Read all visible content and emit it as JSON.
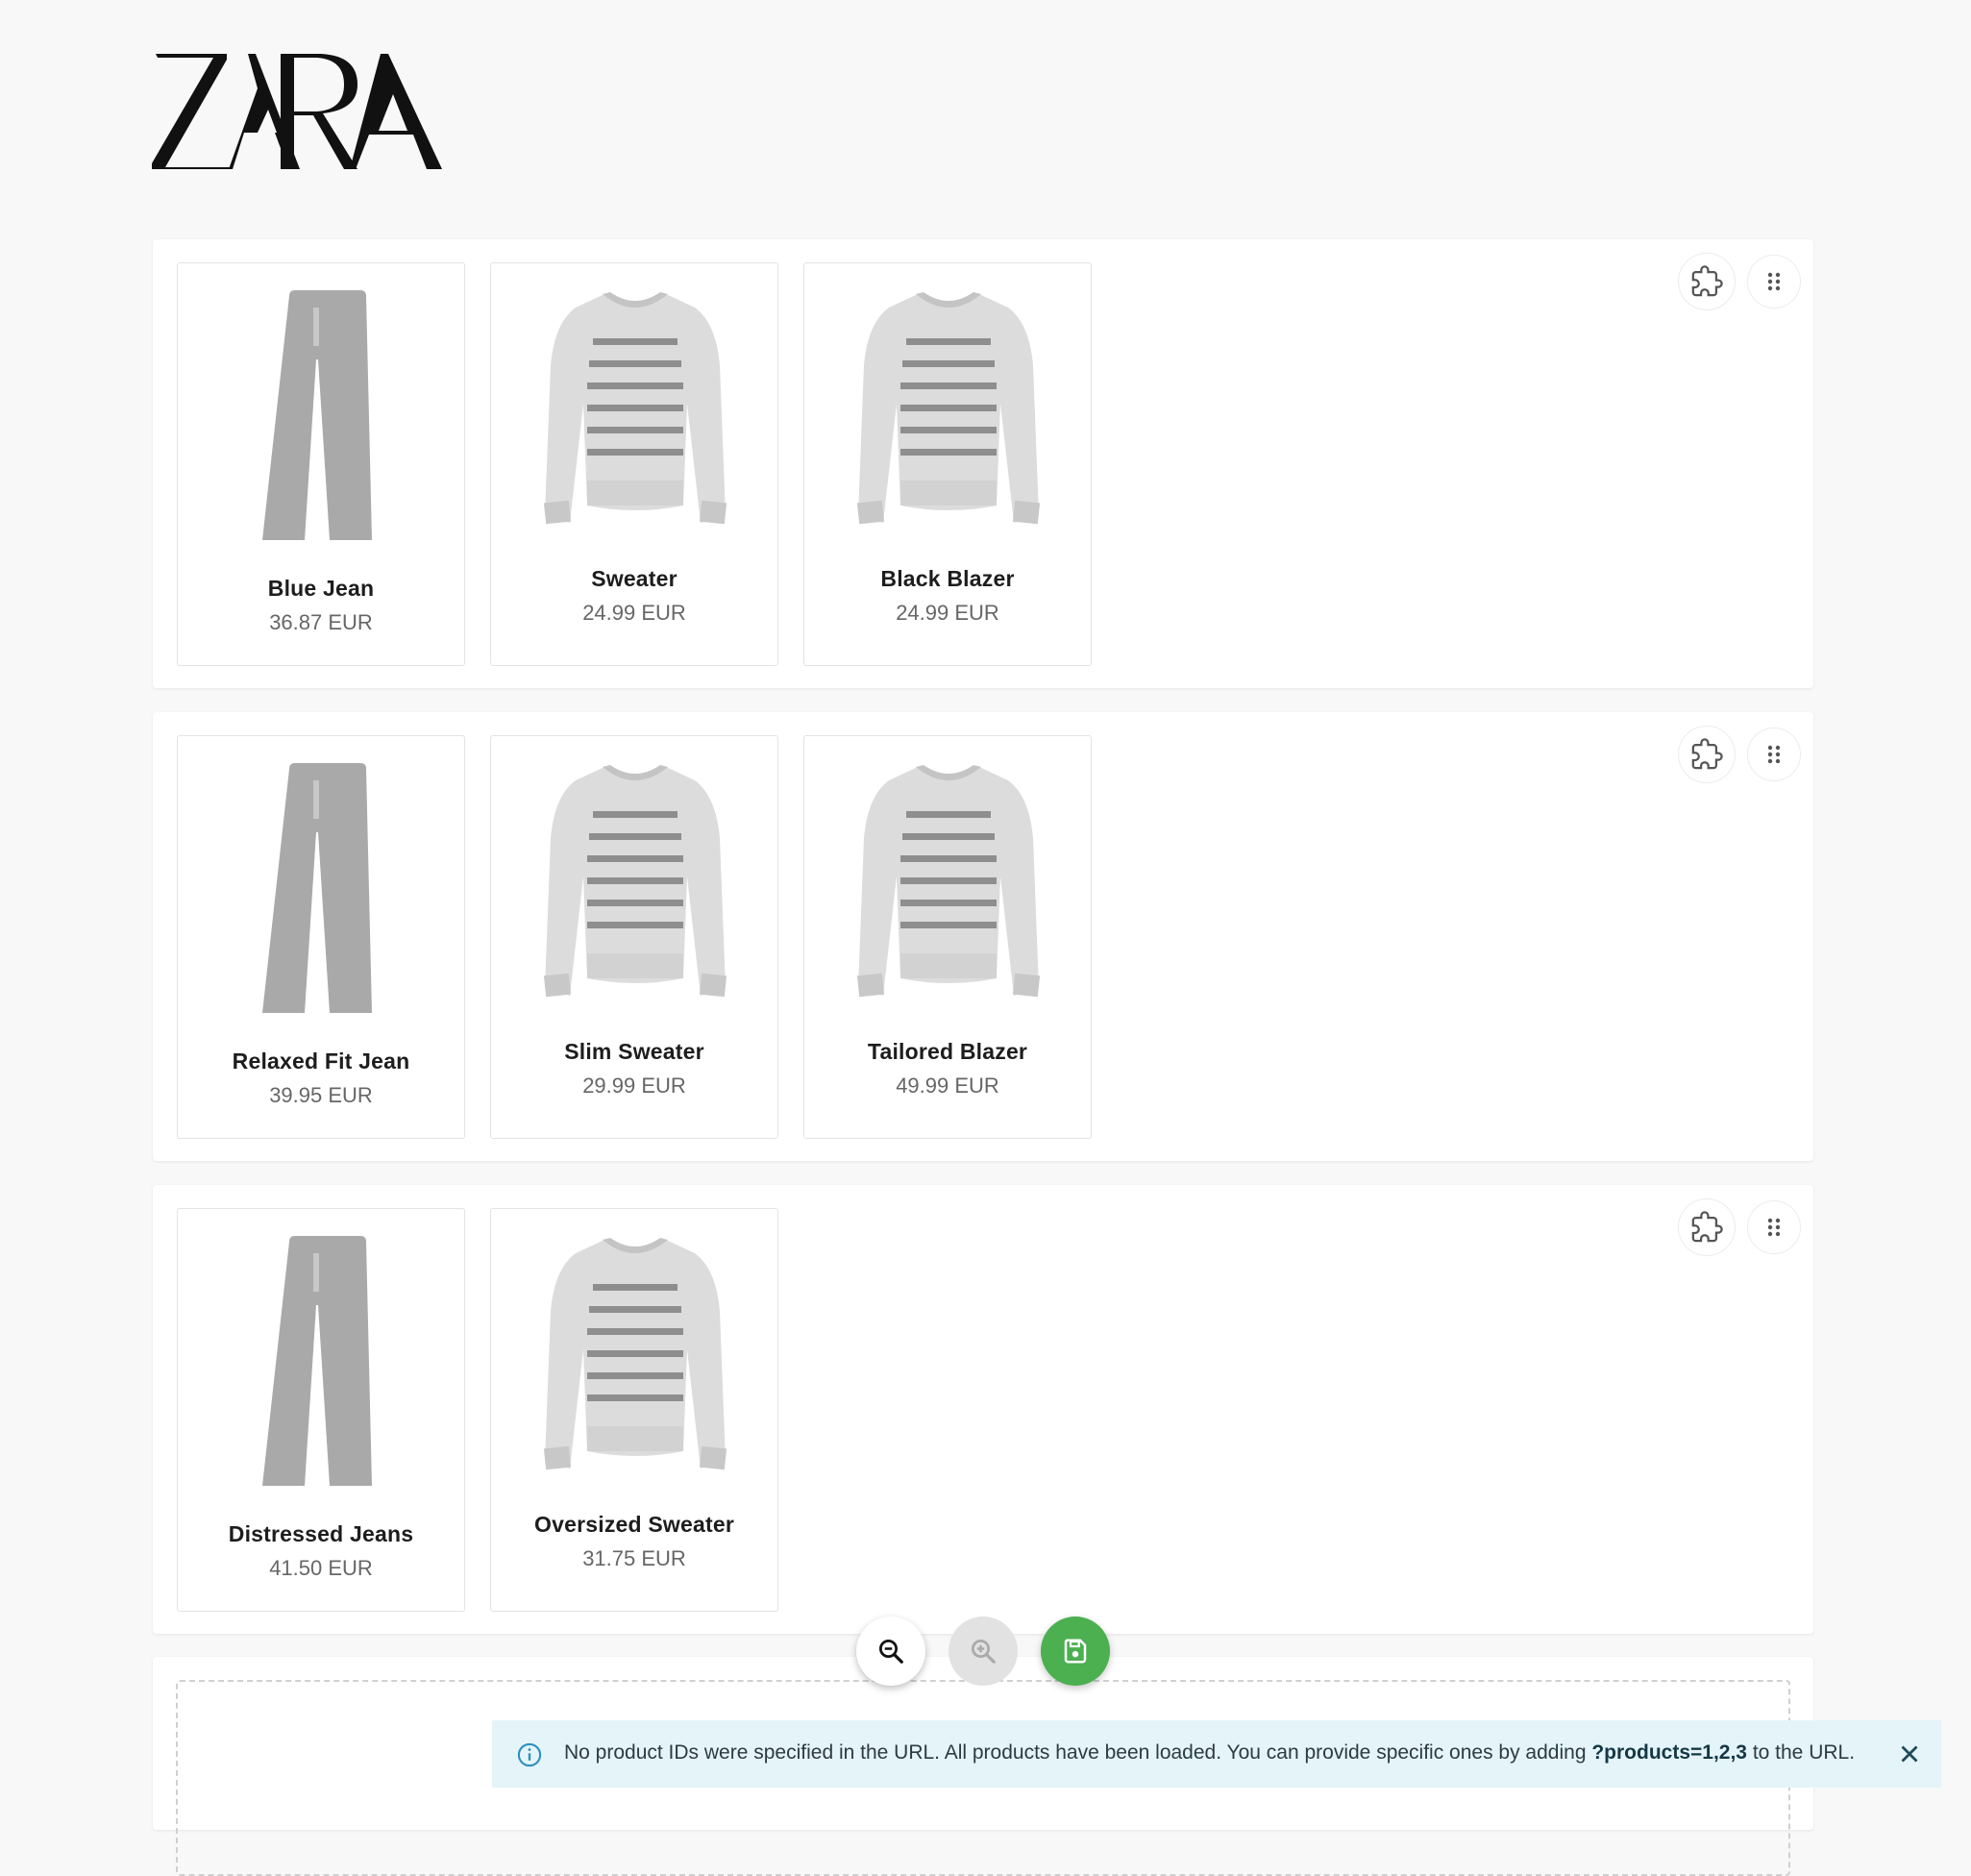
{
  "brand": {
    "logo_text": "ZARA"
  },
  "rows": [
    {
      "products": [
        {
          "name": "Blue Jean",
          "price": "36.87 EUR",
          "icon": "jeans-icon"
        },
        {
          "name": "Sweater",
          "price": "24.99 EUR",
          "icon": "sweater-icon"
        },
        {
          "name": "Black Blazer",
          "price": "24.99 EUR",
          "icon": "sweater-icon"
        }
      ]
    },
    {
      "products": [
        {
          "name": "Relaxed Fit Jean",
          "price": "39.95 EUR",
          "icon": "jeans-icon"
        },
        {
          "name": "Slim Sweater",
          "price": "29.99 EUR",
          "icon": "sweater-icon"
        },
        {
          "name": "Tailored Blazer",
          "price": "49.99 EUR",
          "icon": "sweater-icon"
        }
      ]
    },
    {
      "products": [
        {
          "name": "Distressed Jeans",
          "price": "41.50 EUR",
          "icon": "jeans-icon"
        },
        {
          "name": "Oversized Sweater",
          "price": "31.75 EUR",
          "icon": "sweater-icon"
        }
      ]
    }
  ],
  "row_actions": {
    "template_icon": "puzzle-icon",
    "drag_icon": "drag-handle-icon"
  },
  "toolbar": {
    "zoom_out_icon": "zoom-out-icon",
    "zoom_in_icon": "zoom-in-icon",
    "save_icon": "save-icon",
    "save_color": "#4caf50"
  },
  "alert": {
    "message_before": "No product IDs were specified in the URL. All products have been loaded. You can provide specific ones by adding ",
    "message_code": "?products=1,2,3",
    "message_after": " to the URL.",
    "background": "#e4f4f9"
  }
}
